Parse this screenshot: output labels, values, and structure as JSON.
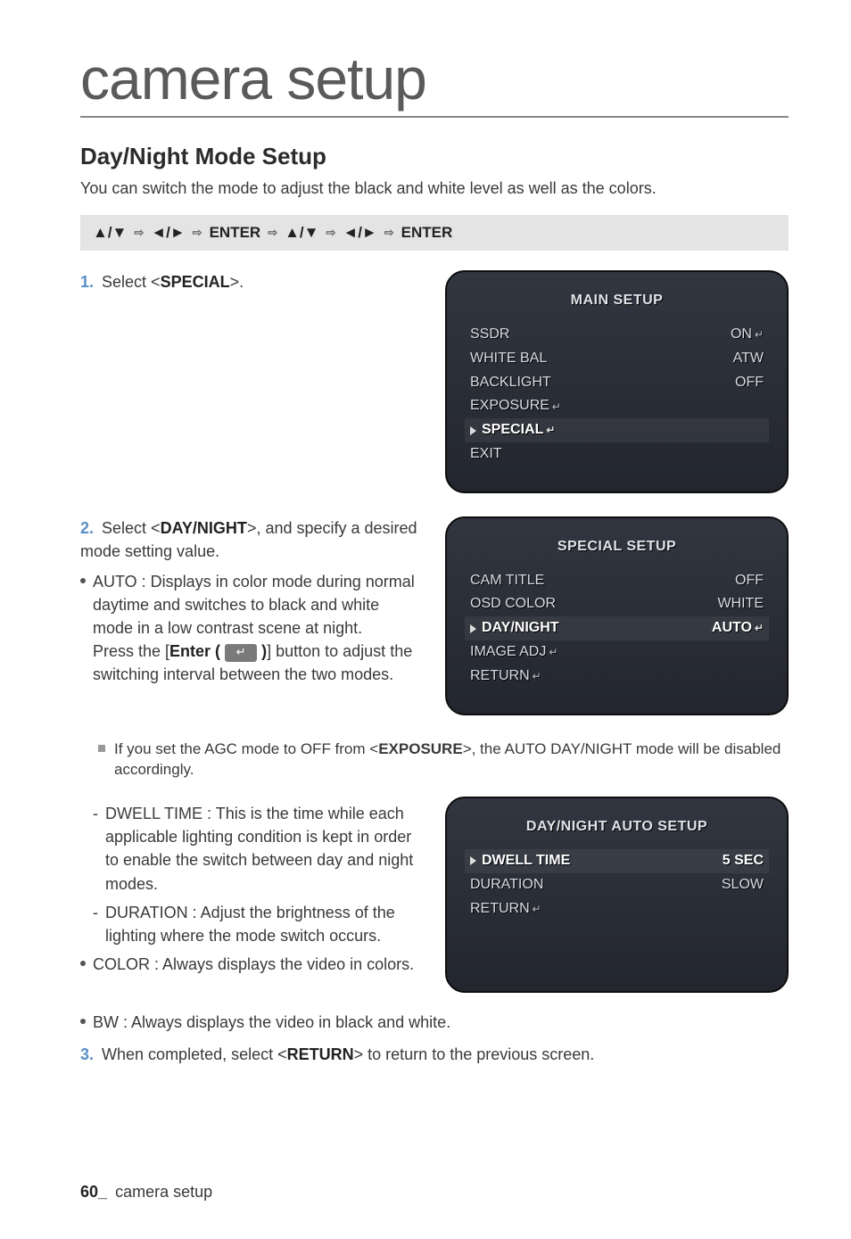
{
  "page": {
    "big_title": "camera setup",
    "section_title": "Day/Night Mode Setup",
    "lead": "You can switch the mode to adjust the black and white level as well as the colors.",
    "footer_page": "60_",
    "footer_text": "camera setup"
  },
  "navbar": {
    "seg1": "▲/▼",
    "seg2": "◄/►",
    "seg3": "ENTER",
    "seg4": "▲/▼",
    "seg5": "◄/►",
    "seg6": "ENTER",
    "arrow": "⇨"
  },
  "steps": {
    "s1_num": "1.",
    "s1_a": "Select <",
    "s1_b": "SPECIAL",
    "s1_c": ">.",
    "s2_num": "2.",
    "s2_a": "Select <",
    "s2_b": "DAY/NIGHT",
    "s2_c": ">, and specify a desired mode setting value.",
    "s3_num": "3.",
    "s3_a": "When completed, select <",
    "s3_b": "RETURN",
    "s3_c": "> to return to the previous screen."
  },
  "bullets": {
    "auto": "AUTO : Displays in color mode during normal daytime and switches to black and white mode in a low contrast scene at night.",
    "auto2a": "Press the [",
    "auto2b": "Enter (",
    "auto2c": ")",
    "auto2d": "] button to adjust the switching interval between the two modes.",
    "note_a": "If you set the AGC mode to OFF from <",
    "note_b": "EXPOSURE",
    "note_c": ">, the AUTO DAY/NIGHT mode will be disabled accordingly.",
    "dwell": "DWELL TIME : This is the time while each applicable lighting condition is kept in order to enable the switch between day and night modes.",
    "duration": "DURATION : Adjust the brightness of the lighting where the mode switch occurs.",
    "color": "COLOR : Always displays the video in colors.",
    "bw": "BW : Always displays the video in black and white."
  },
  "osd1": {
    "title": "MAIN SETUP",
    "r1l": "SSDR",
    "r1r": "ON",
    "r2l": "WHITE BAL",
    "r2r": "ATW",
    "r3l": "BACKLIGHT",
    "r3r": "OFF",
    "r4l": "EXPOSURE",
    "r4r": "",
    "r5l": "SPECIAL",
    "r5r": "",
    "r6l": "EXIT",
    "r6r": ""
  },
  "osd2": {
    "title": "SPECIAL SETUP",
    "r1l": "CAM TITLE",
    "r1r": "OFF",
    "r2l": "OSD COLOR",
    "r2r": "WHITE",
    "r3l": "DAY/NIGHT",
    "r3r": "AUTO",
    "r4l": "IMAGE ADJ",
    "r4r": "",
    "r5l": "RETURN",
    "r5r": ""
  },
  "osd3": {
    "title": "DAY/NIGHT AUTO SETUP",
    "r1l": "DWELL TIME",
    "r1r": "5 SEC",
    "r2l": "DURATION",
    "r2r": "SLOW",
    "r3l": "RETURN",
    "r3r": ""
  },
  "icons": {
    "ret": "↵"
  }
}
